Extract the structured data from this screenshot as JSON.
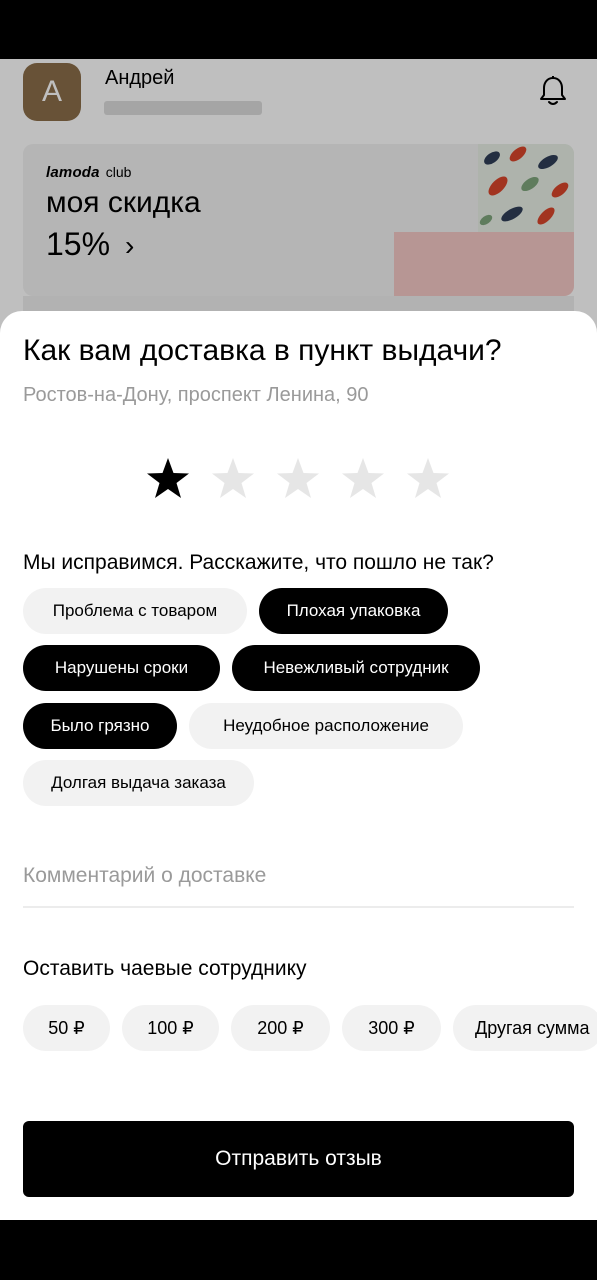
{
  "header": {
    "avatar_letter": "А",
    "user_name": "Андрей"
  },
  "promo": {
    "brand_logo": "lamoda",
    "brand_suffix": "club",
    "title": "моя скидка",
    "value": "15%",
    "arrow": "›"
  },
  "sheet": {
    "title": "Как вам доставка в пункт выдачи?",
    "subtitle": "Ростов-на-Дону, проспект Ленина, 90",
    "rating": {
      "value": 1,
      "max": 5
    },
    "question": "Мы исправимся. Расскажите, что пошло не так?",
    "chips": [
      {
        "label": "Проблема с товаром",
        "selected": false
      },
      {
        "label": "Плохая упаковка",
        "selected": true
      },
      {
        "label": "Нарушены сроки",
        "selected": true
      },
      {
        "label": "Невежливый сотрудник",
        "selected": true
      },
      {
        "label": "Было грязно",
        "selected": true
      },
      {
        "label": "Неудобное расположение",
        "selected": false
      },
      {
        "label": "Долгая выдача заказа",
        "selected": false
      }
    ],
    "comment_placeholder": "Комментарий о доставке",
    "tips_title": "Оставить чаевые сотруднику",
    "tips": [
      "50 ₽",
      "100 ₽",
      "200 ₽",
      "300 ₽",
      "Другая сумма"
    ],
    "submit_label": "Отправить отзыв"
  },
  "colors": {
    "accent": "#000000",
    "chip_inactive": "#f2f2f2",
    "star_inactive": "#e6e6e6",
    "muted_text": "#9a9a9a",
    "avatar": "#8b6e4a"
  },
  "icons": {
    "bell": "bell-icon",
    "star": "star-icon",
    "chevron": "chevron-right-icon"
  }
}
